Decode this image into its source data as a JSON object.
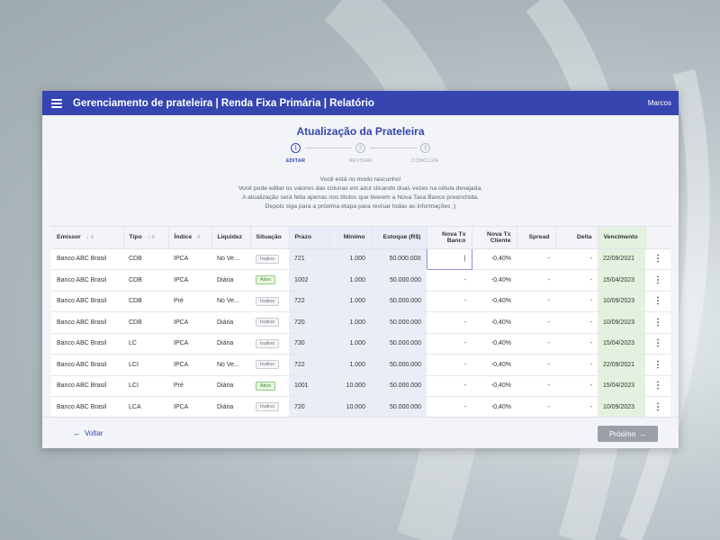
{
  "topbar": {
    "title": "Gerenciamento de prateleira | Renda Fixa Primária | Relatório",
    "user": "Marcos"
  },
  "page": {
    "title": "Atualização da Prateleira"
  },
  "stepper": [
    {
      "num": "1",
      "label": "EDITAR",
      "active": true
    },
    {
      "num": "2",
      "label": "REVISAR",
      "active": false
    },
    {
      "num": "3",
      "label": "CONCLUIR",
      "active": false
    }
  ],
  "info": [
    "Você está no modo rascunho!",
    "Você pode editar os valores das colunas em azul clicando duas vezes na célula desejada.",
    "A atualização será feita apenas nos títulos que tiverem a Nova Taxa Banco preenchida.",
    "Depois siga para a próxima etapa para revisar todas as informações ;)"
  ],
  "table": {
    "columns": {
      "emissor": "Emissor",
      "tipo": "Tipo",
      "indice": "Índice",
      "liquidez": "Liquidez",
      "situacao": "Situação",
      "prazo": "Prazo",
      "minimo": "Mínimo",
      "estoque": "Estoque (R$)",
      "nova_tx_banco_1": "Nova Tx",
      "nova_tx_banco_2": "Banco",
      "nova_tx_cliente_1": "Nova Tx",
      "nova_tx_cliente_2": "Cliente",
      "spread": "Spread",
      "delta": "Delta",
      "vencimento": "Vencimento"
    },
    "rows": [
      {
        "emissor": "Banco ABC Brasil",
        "tipo": "CDB",
        "indice": "IPCA",
        "liquidez": "No Ve...",
        "situacao": "Inativo",
        "prazo": "721",
        "minimo": "1.000",
        "estoque": "50.000.000",
        "nova_tx_banco": "|",
        "nova_tx_cliente": "-0,40%",
        "spread": "-",
        "delta": "-",
        "vencimento": "22/09/2021"
      },
      {
        "emissor": "Banco ABC Brasil",
        "tipo": "CDB",
        "indice": "IPCA",
        "liquidez": "Diária",
        "situacao": "Ativo",
        "prazo": "1002",
        "minimo": "1.000",
        "estoque": "50.000.000",
        "nova_tx_banco": "-",
        "nova_tx_cliente": "-0,40%",
        "spread": "-",
        "delta": "-",
        "vencimento": "15/04/2023"
      },
      {
        "emissor": "Banco ABC Brasil",
        "tipo": "CDB",
        "indice": "Pré",
        "liquidez": "No Ve...",
        "situacao": "Inativo",
        "prazo": "722",
        "minimo": "1.000",
        "estoque": "50.000.000",
        "nova_tx_banco": "-",
        "nova_tx_cliente": "-0,40%",
        "spread": "-",
        "delta": "-",
        "vencimento": "10/09/2023"
      },
      {
        "emissor": "Banco ABC Brasil",
        "tipo": "CDB",
        "indice": "IPCA",
        "liquidez": "Diária",
        "situacao": "Inativo",
        "prazo": "720",
        "minimo": "1.000",
        "estoque": "50.000.000",
        "nova_tx_banco": "-",
        "nova_tx_cliente": "-0,40%",
        "spread": "-",
        "delta": "-",
        "vencimento": "10/09/2023"
      },
      {
        "emissor": "Banco ABC Brasil",
        "tipo": "LC",
        "indice": "IPCA",
        "liquidez": "Diária",
        "situacao": "Inativo",
        "prazo": "730",
        "minimo": "1.000",
        "estoque": "50.000.000",
        "nova_tx_banco": "-",
        "nova_tx_cliente": "-0,40%",
        "spread": "-",
        "delta": "-",
        "vencimento": "15/04/2023"
      },
      {
        "emissor": "Banco ABC Brasil",
        "tipo": "LCI",
        "indice": "IPCA",
        "liquidez": "No Ve...",
        "situacao": "Inativo",
        "prazo": "722",
        "minimo": "1.000",
        "estoque": "50.000.000",
        "nova_tx_banco": "-",
        "nova_tx_cliente": "-0,40%",
        "spread": "-",
        "delta": "-",
        "vencimento": "22/09/2021"
      },
      {
        "emissor": "Banco ABC Brasil",
        "tipo": "LCI",
        "indice": "Pré",
        "liquidez": "Diária",
        "situacao": "Ativo",
        "prazo": "1001",
        "minimo": "10.000",
        "estoque": "50.000.000",
        "nova_tx_banco": "-",
        "nova_tx_cliente": "-0,40%",
        "spread": "-",
        "delta": "-",
        "vencimento": "15/04/2023"
      },
      {
        "emissor": "Banco ABC Brasil",
        "tipo": "LCA",
        "indice": "IPCA",
        "liquidez": "Diária",
        "situacao": "Inativo",
        "prazo": "720",
        "minimo": "10.000",
        "estoque": "50.000.000",
        "nova_tx_banco": "-",
        "nova_tx_cliente": "-0,40%",
        "spread": "-",
        "delta": "-",
        "vencimento": "10/09/2023"
      }
    ]
  },
  "footer": {
    "back_label": "Voltar",
    "next_label": "Próximo"
  },
  "icons": {
    "menu": "menu-icon",
    "back": "arrow-left-icon",
    "next": "arrow-right-icon",
    "row_actions": "kebab-menu-icon",
    "sort": "sort-down-icon",
    "filter": "filter-icon"
  },
  "colors": {
    "primary": "#3645b0",
    "editable_column": "#eaedf7",
    "vencimento_column": "#e4f1df",
    "active_badge": "#3f8f2f"
  }
}
